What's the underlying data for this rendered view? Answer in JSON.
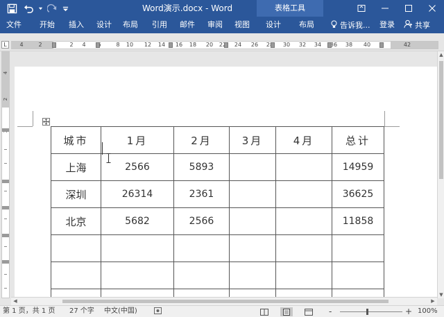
{
  "titlebar": {
    "doc_title": "Word演示.docx  -  Word",
    "contextual_title": "表格工具",
    "bg_color": "#2b579a",
    "contextual_color": "#3e6bb0",
    "qat_icons": [
      "save-icon",
      "undo-icon",
      "redo-icon"
    ],
    "window_icons": [
      "ribbon-display-icon",
      "minimize-icon",
      "maximize-icon",
      "close-icon"
    ]
  },
  "ribbon": {
    "tabs": [
      "文件",
      "开始",
      "插入",
      "设计",
      "布局",
      "引用",
      "邮件",
      "审阅",
      "视图",
      "设计",
      "布局"
    ],
    "tell_me": "告诉我...",
    "login": "登录",
    "share": "共享"
  },
  "ruler": {
    "corner": "L",
    "numbers": [
      "4",
      "2",
      "2",
      "4",
      "6",
      "8",
      "10",
      "12",
      "14",
      "16",
      "18",
      "20",
      "22",
      "24",
      "26",
      "28",
      "30",
      "32",
      "34",
      "36",
      "38",
      "40",
      "42"
    ]
  },
  "vruler": {
    "numbers": [
      "4",
      "2",
      "2"
    ]
  },
  "table": {
    "header": [
      "城市",
      "1月",
      "2月",
      "3月",
      "4月",
      "总计"
    ],
    "rows": [
      [
        "上海",
        "2566",
        "5893",
        "",
        "",
        "14959"
      ],
      [
        "深圳",
        "26314",
        "2361",
        "",
        "",
        "36625"
      ],
      [
        "北京",
        "5682",
        "2566",
        "",
        "",
        "11858"
      ],
      [
        "",
        "",
        "",
        "",
        "",
        ""
      ],
      [
        "",
        "",
        "",
        "",
        "",
        ""
      ],
      [
        "",
        "",
        "",
        "",
        "",
        ""
      ]
    ]
  },
  "status": {
    "page": "第 1 页，共 1 页",
    "words": "27 个字",
    "language": "中文(中国)",
    "zoom": "100%",
    "zoom_minus": "-",
    "zoom_plus": "+"
  }
}
